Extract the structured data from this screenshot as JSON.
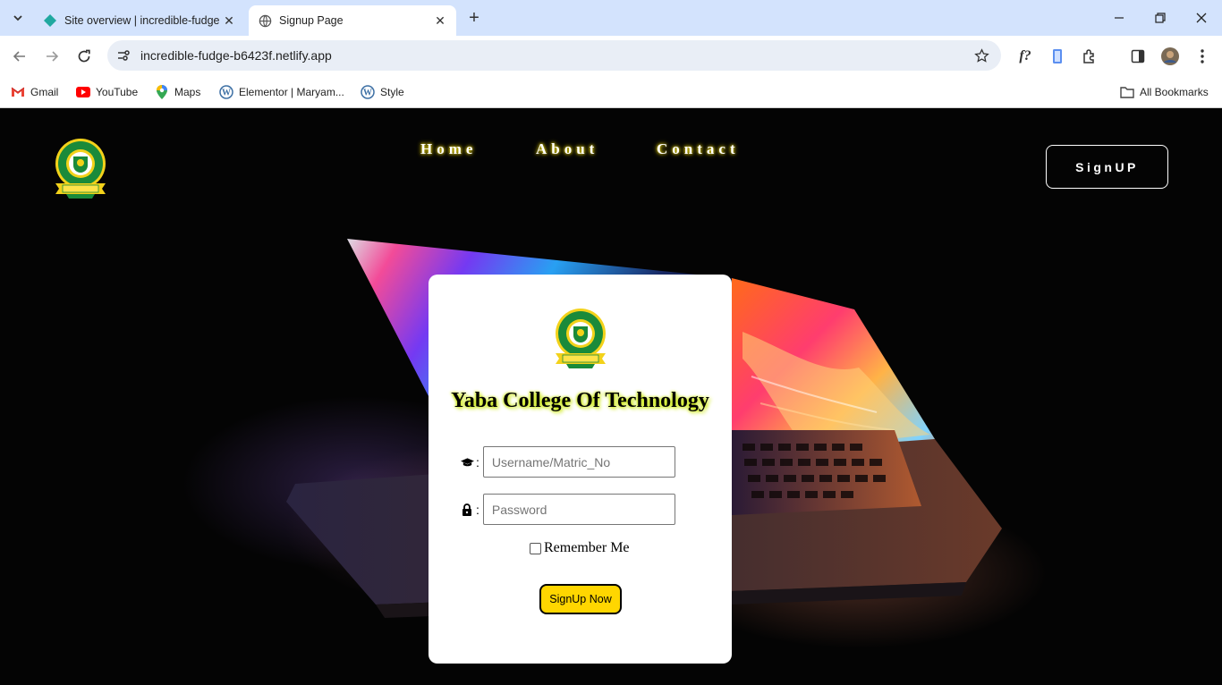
{
  "browser": {
    "tabs": [
      {
        "title": "Site overview | incredible-fudge",
        "active": false
      },
      {
        "title": "Signup Page",
        "active": true
      }
    ],
    "url": "incredible-fudge-b6423f.netlify.app",
    "bookmarks": [
      {
        "label": "Gmail",
        "icon": "gmail-icon"
      },
      {
        "label": "YouTube",
        "icon": "youtube-icon"
      },
      {
        "label": "Maps",
        "icon": "maps-icon"
      },
      {
        "label": "Elementor | Maryam...",
        "icon": "wordpress-icon"
      },
      {
        "label": "Style",
        "icon": "wordpress-icon"
      }
    ],
    "all_bookmarks": "All Bookmarks",
    "extension_label": "f?"
  },
  "site": {
    "nav": {
      "home": "Home",
      "about": "About",
      "contact": "Contact"
    },
    "signup_button": "SignUP",
    "colors": {
      "accent": "#ffd600",
      "glow": "#e6d200",
      "logo_green": "#1a8a3a"
    }
  },
  "form": {
    "title": "Yaba College Of Technology",
    "username": {
      "placeholder": "Username/Matric_No",
      "value": "",
      "icon": "graduation-cap-icon"
    },
    "password": {
      "placeholder": "Password",
      "value": "",
      "icon": "lock-icon"
    },
    "colon": ":",
    "remember_label": "Remember Me",
    "remember_checked": false,
    "submit_label": "SignUp Now"
  }
}
